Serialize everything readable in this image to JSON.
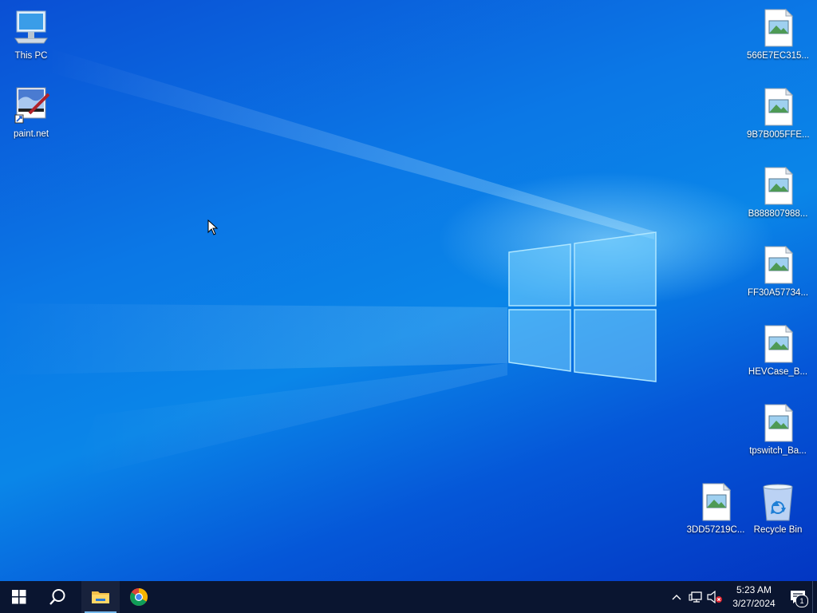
{
  "desktop": {
    "left_icons": [
      {
        "label": "This PC",
        "icon": "this-pc-icon"
      },
      {
        "label": "paint.net",
        "icon": "paint-net-icon"
      }
    ],
    "right_icons": [
      {
        "label": "566E7EC315...",
        "icon": "image-file-icon"
      },
      {
        "label": "9B7B005FFE...",
        "icon": "image-file-icon"
      },
      {
        "label": "B888807988...",
        "icon": "image-file-icon"
      },
      {
        "label": "FF30A57734...",
        "icon": "image-file-icon"
      },
      {
        "label": "HEVCase_B...",
        "icon": "image-file-icon"
      },
      {
        "label": "tpswitch_Ba...",
        "icon": "image-file-icon"
      },
      {
        "label": "3DD57219C...",
        "icon": "image-file-icon"
      },
      {
        "label": "Recycle Bin",
        "icon": "recycle-bin-icon"
      }
    ]
  },
  "taskbar": {
    "pinned": [
      {
        "name": "start",
        "icon": "windows-start-icon"
      },
      {
        "name": "search",
        "icon": "search-icon"
      },
      {
        "name": "file-explorer",
        "icon": "file-explorer-icon",
        "active": true
      },
      {
        "name": "chrome",
        "icon": "chrome-icon"
      }
    ],
    "tray": {
      "time": "5:23 AM",
      "date": "3/27/2024",
      "notification_count": "1"
    }
  },
  "colors": {
    "taskbar_bg": "#0a1530",
    "desktop_blue": "#0a86e8",
    "active_indicator": "#76b9ed"
  }
}
